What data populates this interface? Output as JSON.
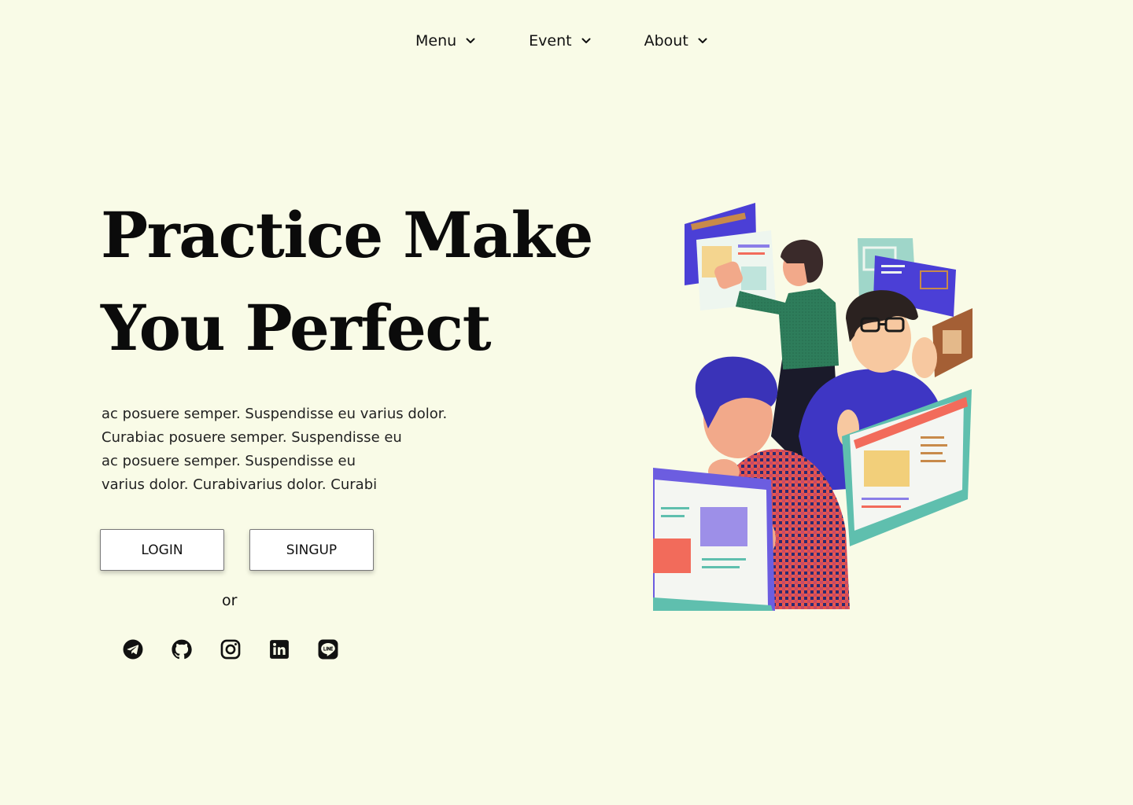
{
  "nav": {
    "items": [
      {
        "label": "Menu",
        "icon": "chevron-down-icon"
      },
      {
        "label": "Event",
        "icon": "chevron-down-icon"
      },
      {
        "label": "About",
        "icon": "chevron-down-icon"
      }
    ]
  },
  "hero": {
    "title_line_1": "Practice Make",
    "title_line_2": "You Perfect",
    "body_lines": [
      "ac posuere semper. Suspendisse eu varius dolor.",
      "Curabiac posuere semper. Suspendisse eu",
      "ac posuere semper. Suspendisse eu",
      "varius dolor. Curabivarius dolor. Curabi"
    ]
  },
  "actions": {
    "login_label": "LOGIN",
    "signup_label": "SINGUP",
    "or_label": "or"
  },
  "social": {
    "icons": [
      "telegram-icon",
      "github-icon",
      "instagram-icon",
      "linkedin-icon",
      "line-icon"
    ]
  },
  "colors": {
    "background": "#f9fbe7",
    "text": "#111111",
    "button_bg": "#ffffff",
    "accent_purple": "#4b3fd6",
    "accent_teal": "#5fbfae",
    "accent_coral": "#f26b5b",
    "accent_green_shirt": "#2e7d5b"
  }
}
